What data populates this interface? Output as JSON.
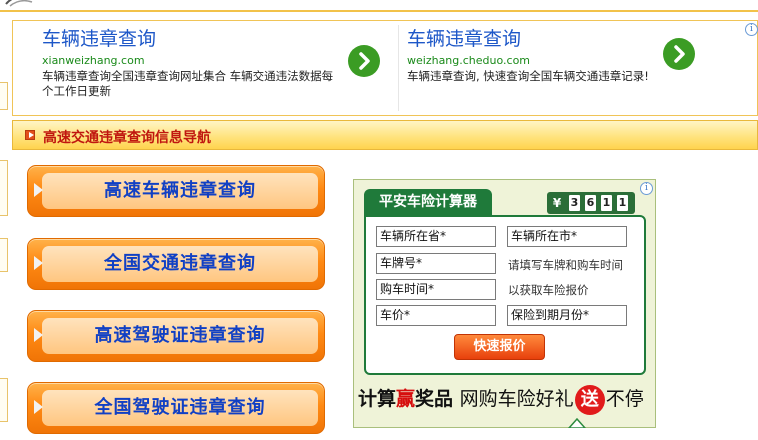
{
  "ads": [
    {
      "title": "车辆违章查询",
      "url": "xianweizhang.com",
      "desc": "车辆违章查询全国违章查询网址集合 车辆交通违法数据每个工作日更新"
    },
    {
      "title": "车辆违章查询",
      "url": "weizhang.cheduo.com",
      "desc": "车辆违章查询, 快速查询全国车辆交通违章记录!"
    }
  ],
  "ad_info_icon": "info-icon",
  "section": {
    "title": "高速交通违章查询信息导航"
  },
  "nav": [
    {
      "label": "高速车辆违章查询"
    },
    {
      "label": "全国交通违章查询"
    },
    {
      "label": "高速驾驶证违章查询"
    },
    {
      "label": "全国驾驶证违章查询"
    }
  ],
  "insurance": {
    "title": "平安车险计算器",
    "counter_symbol": "¥",
    "counter_digits": [
      "3",
      "6",
      "1",
      "1"
    ],
    "fields": {
      "province": "车辆所在省*",
      "city": "车辆所在市*",
      "plate": "车牌号*",
      "purchase_date": "购车时间*",
      "price": "车价*",
      "expiry": "保险到期月份*"
    },
    "hints": {
      "line1": "请填写车牌和购车时间",
      "line2": "以获取车险报价"
    },
    "quote_button": "快速报价",
    "promo": {
      "part1": "计算",
      "part2": "赢",
      "part3": "奖品",
      "part4": "网购车险好礼",
      "part5": "送",
      "part6": "不停"
    }
  },
  "colors": {
    "accent_orange": "#ff8a14",
    "nav_text": "#1140c4",
    "ad_title": "#1d57c8",
    "ad_url": "#1a8a1a",
    "insurance_green": "#1f7a3a"
  }
}
